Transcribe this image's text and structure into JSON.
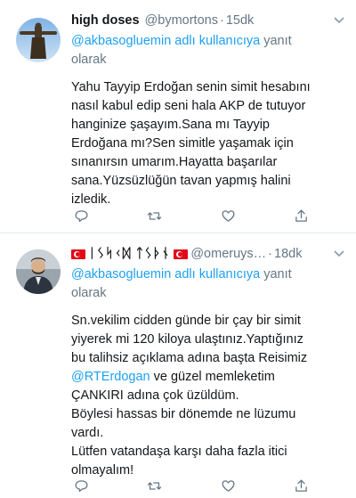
{
  "tweets": [
    {
      "display_name": "high doses",
      "handle": "@bymortons",
      "time": "15dk",
      "reply_mention": "@akbasogluemin adlı kullanıcıya",
      "reply_suffix_1": "yanıt",
      "reply_suffix_2": "olarak",
      "text_lines": [
        "Yahu Tayyip Erdoğan senin simit hesabını",
        "nasıl kabul edip seni hala AKP de tutuyor",
        "hanginize şaşayım.Sana mı Tayyip",
        "Erdoğana mı?Sen simitle yaşamak için",
        "sınanırsın umarım.Hayatta başarılar",
        "sana.Yüzsüzlüğün tavan yapmış halini",
        "izledik."
      ],
      "avatar_icon": "statue-avatar-icon"
    },
    {
      "display_name_text": "ᛁᛊᛋᚲᛞ ᛏᛊᚦᚾ",
      "handle": "@omeruys…",
      "time": "18dk",
      "reply_mention": "@akbasogluemin adlı kullanıcıya",
      "reply_suffix_1": "yanıt",
      "reply_suffix_2": "olarak",
      "text_line_1": "Sn.vekilim cidden günde bir çay bir simit",
      "text_line_2": "yiyerek mi 120 kiloya ulaştınız.Yaptığınız",
      "text_line_3": "bu talihsiz açıklama adına başta Reisimiz",
      "text_mention": "@RTErdogan",
      "text_line_4_rest": " ve güzel memleketim",
      "text_line_5": "ÇANKIRI adına çok üzüldüm.",
      "text_line_6": "Böylesi hassas bir dönemde ne lüzumu",
      "text_line_7": "vardı.",
      "text_line_8": "Lütfen vatandaşa karşı daha fazla itici",
      "text_line_9": "olmayalım!",
      "avatar_icon": "man-avatar-icon"
    }
  ],
  "colors": {
    "link": "#1da1f2",
    "secondary": "#657786",
    "text": "#14171a",
    "divider": "#e1e8ed",
    "flag_red": "#e30a17"
  },
  "icons": [
    "reply-icon",
    "retweet-icon",
    "like-icon",
    "share-icon",
    "chevron-down-icon",
    "turkish-flag-icon"
  ]
}
